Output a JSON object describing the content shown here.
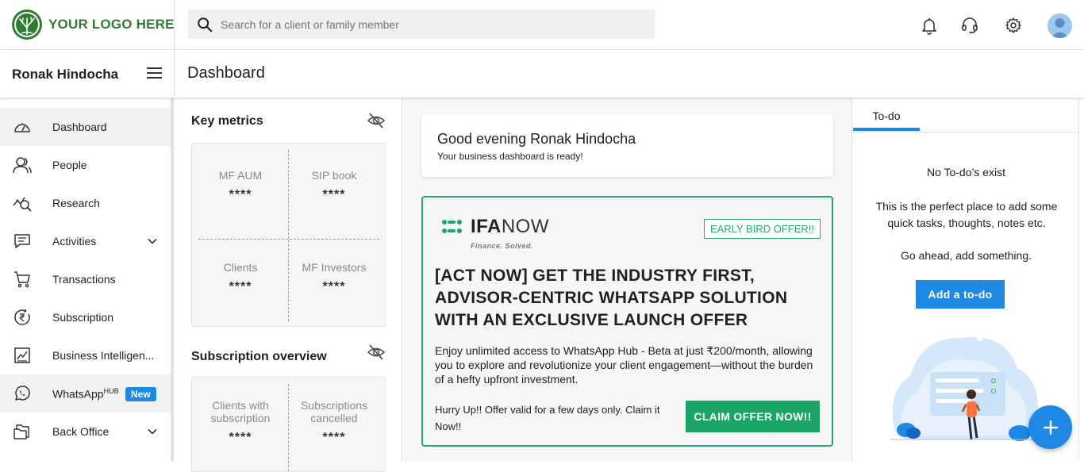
{
  "header": {
    "logo_text": "YOUR LOGO HERE",
    "search_placeholder": "Search for a client or family member",
    "icons": [
      "bell-icon",
      "headset-icon",
      "gear-icon",
      "avatar"
    ]
  },
  "subheader": {
    "user_name": "Ronak Hindocha",
    "page_title": "Dashboard"
  },
  "sidebar": {
    "items": [
      {
        "label": "Dashboard",
        "icon": "gauge-icon",
        "active": true
      },
      {
        "label": "People",
        "icon": "people-icon"
      },
      {
        "label": "Research",
        "icon": "research-icon"
      },
      {
        "label": "Activities",
        "icon": "chat-icon",
        "expandable": true
      },
      {
        "label": "Transactions",
        "icon": "cart-icon"
      },
      {
        "label": "Subscription",
        "icon": "rupee-icon"
      },
      {
        "label": "Business Intelligen...",
        "icon": "chart-icon"
      },
      {
        "label": "WhatsApp",
        "superscript": "HUB",
        "badge": "New",
        "icon": "whatsapp-icon"
      },
      {
        "label": "Back Office",
        "icon": "folder-icon",
        "expandable": true
      }
    ]
  },
  "key_metrics": {
    "title": "Key metrics",
    "cells": [
      {
        "label": "MF AUM",
        "value": "****"
      },
      {
        "label": "SIP book",
        "value": "****"
      },
      {
        "label": "Clients",
        "value": "****"
      },
      {
        "label": "MF Investors",
        "value": "****"
      }
    ]
  },
  "subscription_overview": {
    "title": "Subscription overview",
    "cells": [
      {
        "label": "Clients with subscription",
        "value": "****"
      },
      {
        "label": "Subscriptions cancelled",
        "value": "****"
      }
    ]
  },
  "greeting": {
    "title": "Good evening Ronak Hindocha",
    "subtitle": "Your business dashboard is ready!"
  },
  "offer": {
    "brand_bold": "IFA",
    "brand_light": "NOW",
    "brand_tagline": "Finance. Solved.",
    "tag": "EARLY BIRD OFFER!!",
    "headline": "[ACT NOW] GET THE INDUSTRY FIRST, ADVISOR-CENTRIC WHATSAPP SOLUTION WITH AN EXCLUSIVE LAUNCH OFFER",
    "body": "Enjoy unlimited access to WhatsApp Hub - Beta at just ₹200/month, allowing you to explore and revolutionize your client engagement—without the burden of a hefty upfront investment.",
    "hurry": "Hurry Up!! Offer valid for a few days only. Claim it Now!!",
    "cta": "CLAIM OFFER NOW!!",
    "accent_color": "#26a66a"
  },
  "todo": {
    "tab": "To-do",
    "empty_title": "No To-do’s exist",
    "description": "This is the perfect place to add some quick tasks, thoughts, notes etc.",
    "prompt": "Go ahead, add something.",
    "button": "Add a to-do"
  },
  "fab": {
    "icon": "plus-icon"
  },
  "colors": {
    "primary": "#1e88e5",
    "green": "#2e7d32"
  }
}
